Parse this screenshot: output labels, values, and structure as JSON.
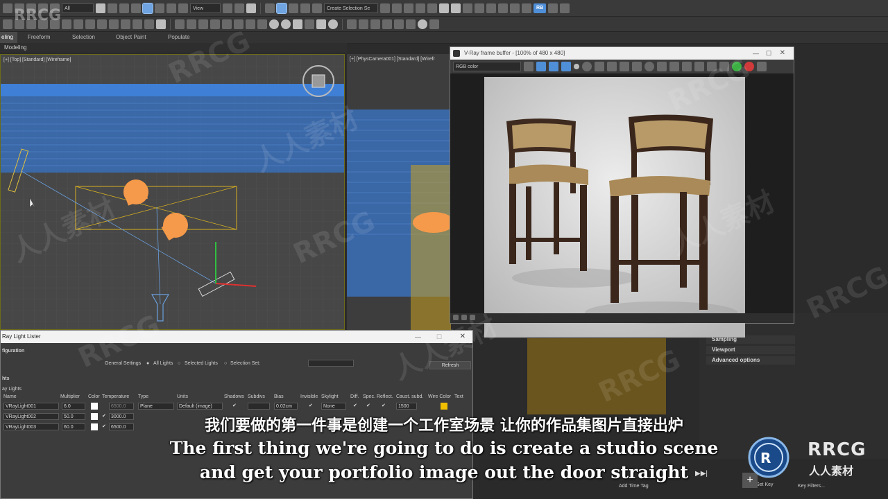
{
  "toolbar": {
    "filter_dropdown": "All",
    "view_dropdown": "View",
    "create_selection_set": "Create Selection Se",
    "rb_badge": "RB"
  },
  "ribbon": {
    "tabs": [
      "eling",
      "Freeform",
      "Selection",
      "Object Paint",
      "Populate"
    ],
    "active_tab": "eling",
    "sub_label": "Modeling"
  },
  "viewports": {
    "top_label": "[+] [Top] [Standard] [Wireframe]",
    "cam_label": "[+] [PhysCamera001] [Standard] [Wirefr"
  },
  "vfb": {
    "title": "V-Ray frame buffer - [100% of 480 x 480]",
    "channel": "RGB color",
    "colors": {
      "title_bg": "#f0f0f0",
      "render_bg": "#dcdcdc"
    }
  },
  "right_panel": {
    "items": [
      "Sampling",
      "Viewport",
      "Advanced options"
    ]
  },
  "lister": {
    "title": "Ray Light Lister",
    "section_config": "figuration",
    "general_settings": "General Settings",
    "all_lights": "All Lights",
    "selected_lights": "Selected Lights",
    "selection_set": "Selection Set:",
    "refresh": "Refresh",
    "section_lights": "hts",
    "group_label": "ay Lights",
    "headers": [
      "Name",
      "Multiplier",
      "Color",
      "Temperature",
      "Type",
      "Units",
      "Shadows",
      "Subdivs",
      "Bias",
      "Invisible",
      "Skylight",
      "Diff.",
      "Spec.",
      "Reflect.",
      "Caust. subd.",
      "Wire Color",
      "Text"
    ],
    "rows": [
      {
        "name": "VRayLight001",
        "multiplier": "6.0",
        "temperature": "6500.0",
        "type": "Plane",
        "units": "Default (image)",
        "bias": "0.02cm",
        "skylight": "None",
        "caust": "1500"
      },
      {
        "name": "VRayLight002",
        "multiplier": "50.0",
        "temperature": "3000.0"
      },
      {
        "name": "VRayLight003",
        "multiplier": "60.0",
        "temperature": "6500.0"
      }
    ]
  },
  "subtitles": {
    "cn": "我们要做的第一件事是创建一个工作室场景 让你的作品集图片直接出炉",
    "en1": "The first thing we're going to do is create a studio scene",
    "en2": "and get your portfolio image out the door straight"
  },
  "watermark": {
    "text1": "RRCG",
    "text2": "人人素材"
  },
  "logo": {
    "main": "RRCG",
    "sub": "人人素材"
  },
  "timeline": {
    "add_time_tag": "Add Time Tag",
    "key_filters": "Key Filters...",
    "set_key": "Set Key"
  }
}
